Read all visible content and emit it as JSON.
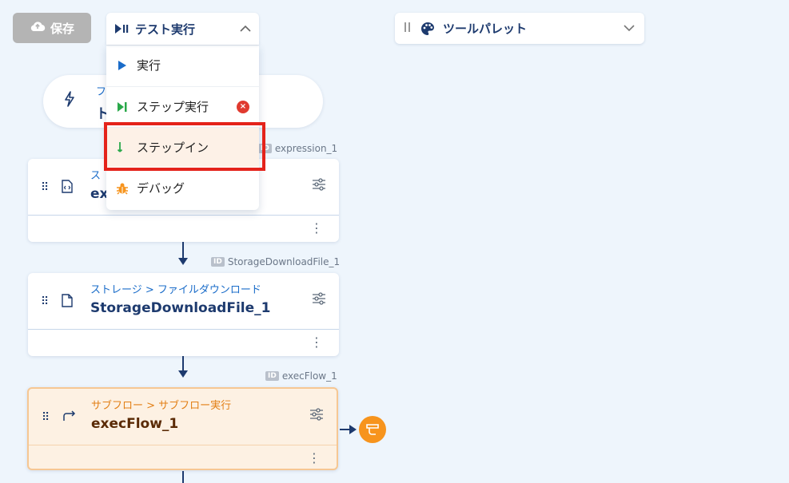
{
  "toolbar": {
    "save_label": "保存",
    "test_run_label": "テスト実行",
    "palette_label": "ツールパレット"
  },
  "test_menu": {
    "items": [
      {
        "label": "実行"
      },
      {
        "label": "ステップ実行"
      },
      {
        "label": "ステップイン"
      },
      {
        "label": "デバッグ"
      }
    ]
  },
  "trigger": {
    "category": "フ",
    "name": "ト"
  },
  "nodes": [
    {
      "id_label": "expression_1",
      "category": "ス",
      "name": "ex"
    },
    {
      "id_label": "StorageDownloadFile_1",
      "category": "ストレージ > ファイルダウンロード",
      "name": "StorageDownloadFile_1"
    },
    {
      "id_label": "execFlow_1",
      "category": "サブフロー > サブフロー実行",
      "name": "execFlow_1"
    }
  ],
  "id_badge_text": "ID",
  "colors": {
    "background": "#eef5fc",
    "accent_blue": "#1d3a6e",
    "link_blue": "#1a6cc9",
    "subflow_orange": "#f7941d",
    "highlight_red": "#e4231b",
    "step_green": "#2aa84a"
  }
}
